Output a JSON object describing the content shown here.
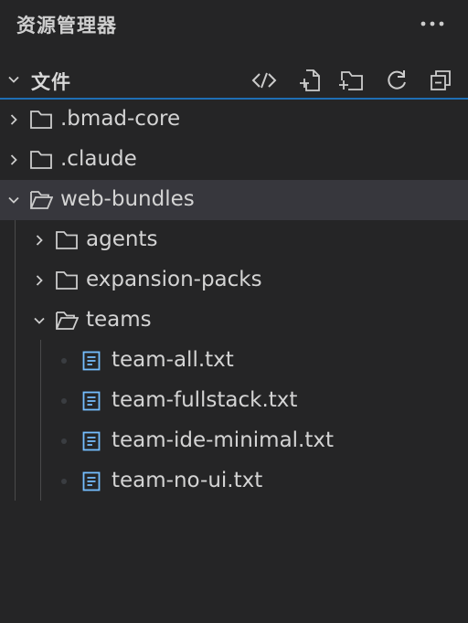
{
  "header": {
    "title": "资源管理器",
    "more_icon": "ellipsis-icon"
  },
  "section": {
    "title": "文件",
    "actions": [
      "open-remote-icon",
      "new-file-icon",
      "new-folder-icon",
      "refresh-icon",
      "collapse-all-icon"
    ]
  },
  "colors": {
    "background": "#252526",
    "selected_row": "#37373d",
    "focus_border": "#1f6fb5",
    "file_icon": "#75beff",
    "text": "#d4d4d4"
  },
  "tree": {
    "items": [
      {
        "label": ".bmad-core",
        "type": "folder",
        "expanded": false
      },
      {
        "label": ".claude",
        "type": "folder",
        "expanded": false
      },
      {
        "label": "web-bundles",
        "type": "folder",
        "expanded": true
      },
      {
        "label": "agents",
        "type": "folder",
        "expanded": false
      },
      {
        "label": "expansion-packs",
        "type": "folder",
        "expanded": false
      },
      {
        "label": "teams",
        "type": "folder",
        "expanded": true
      },
      {
        "label": "team-all.txt",
        "type": "file"
      },
      {
        "label": "team-fullstack.txt",
        "type": "file"
      },
      {
        "label": "team-ide-minimal.txt",
        "type": "file"
      },
      {
        "label": "team-no-ui.txt",
        "type": "file"
      }
    ]
  }
}
